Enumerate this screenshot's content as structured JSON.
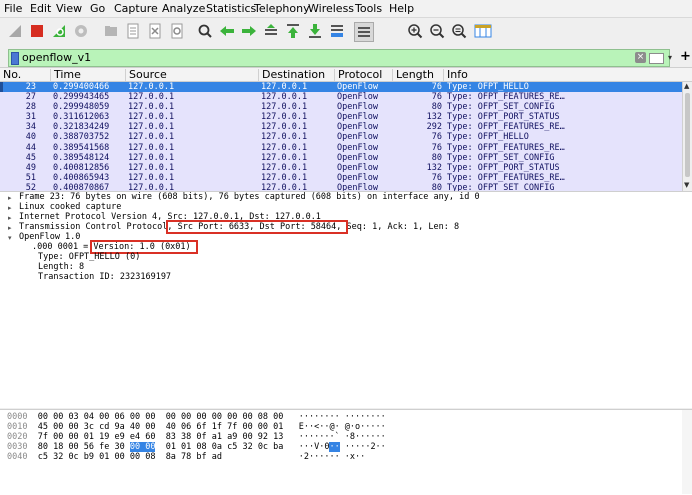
{
  "menu": [
    "File",
    "Edit",
    "View",
    "Go",
    "Capture",
    "Analyze",
    "Statistics",
    "Telephony",
    "Wireless",
    "Tools",
    "Help"
  ],
  "toolbar": {
    "icons": [
      "shark-fin-icon",
      "stop-icon",
      "restart-icon",
      "options-icon",
      "open-file-icon",
      "save-file-icon",
      "close-file-icon",
      "reload-icon",
      "find-icon",
      "go-back-icon",
      "go-forward-icon",
      "go-to-packet-icon",
      "first-packet-icon",
      "last-packet-icon",
      "auto-scroll-icon",
      "colorize-icon",
      "zoom-in-icon",
      "zoom-out-icon",
      "normal-size-icon",
      "resize-columns-icon"
    ]
  },
  "filter": {
    "value": "openflow_v1",
    "accent": "#b9f3b9",
    "clear_glyph": "×",
    "dropdown_glyph": "▾",
    "add_glyph": "+"
  },
  "packet_list": {
    "columns": [
      "No.",
      "Time",
      "Source",
      "Destination",
      "Protocol",
      "Length",
      "Info"
    ],
    "rows": [
      {
        "no": "23",
        "time": "0.299400466",
        "src": "127.0.0.1",
        "dst": "127.0.0.1",
        "proto": "OpenFlow",
        "len": "76",
        "info": "Type: OFPT_HELLO",
        "selected": true
      },
      {
        "no": "27",
        "time": "0.299943465",
        "src": "127.0.0.1",
        "dst": "127.0.0.1",
        "proto": "OpenFlow",
        "len": "76",
        "info": "Type: OFPT_FEATURES_RE…"
      },
      {
        "no": "28",
        "time": "0.299948059",
        "src": "127.0.0.1",
        "dst": "127.0.0.1",
        "proto": "OpenFlow",
        "len": "80",
        "info": "Type: OFPT_SET_CONFIG"
      },
      {
        "no": "31",
        "time": "0.311612063",
        "src": "127.0.0.1",
        "dst": "127.0.0.1",
        "proto": "OpenFlow",
        "len": "132",
        "info": "Type: OFPT_PORT_STATUS"
      },
      {
        "no": "34",
        "time": "0.321834249",
        "src": "127.0.0.1",
        "dst": "127.0.0.1",
        "proto": "OpenFlow",
        "len": "292",
        "info": "Type: OFPT_FEATURES_RE…"
      },
      {
        "no": "40",
        "time": "0.388703752",
        "src": "127.0.0.1",
        "dst": "127.0.0.1",
        "proto": "OpenFlow",
        "len": "76",
        "info": "Type: OFPT_HELLO"
      },
      {
        "no": "44",
        "time": "0.389541568",
        "src": "127.0.0.1",
        "dst": "127.0.0.1",
        "proto": "OpenFlow",
        "len": "76",
        "info": "Type: OFPT_FEATURES_RE…"
      },
      {
        "no": "45",
        "time": "0.389548124",
        "src": "127.0.0.1",
        "dst": "127.0.0.1",
        "proto": "OpenFlow",
        "len": "80",
        "info": "Type: OFPT_SET_CONFIG"
      },
      {
        "no": "49",
        "time": "0.400812856",
        "src": "127.0.0.1",
        "dst": "127.0.0.1",
        "proto": "OpenFlow",
        "len": "132",
        "info": "Type: OFPT_PORT_STATUS"
      },
      {
        "no": "51",
        "time": "0.400865943",
        "src": "127.0.0.1",
        "dst": "127.0.0.1",
        "proto": "OpenFlow",
        "len": "76",
        "info": "Type: OFPT_FEATURES_RE…"
      },
      {
        "no": "52",
        "time": "0.400870867",
        "src": "127.0.0.1",
        "dst": "127.0.0.1",
        "proto": "OpenFlow",
        "len": "80",
        "info": "Type: OFPT_SET_CONFIG"
      }
    ],
    "selected_color": "#3584e4",
    "row_color": "#e5e3fc"
  },
  "details": {
    "frame": "Frame 23: 76 bytes on wire (608 bits), 76 bytes captured (608 bits) on interface any, id 0",
    "linux": "Linux cooked capture",
    "ip": "Internet Protocol Version 4, Src: 127.0.0.1, Dst: 127.0.0.1",
    "tcp_prefix": "Transmission Control Protocol, ",
    "tcp_ports": "Src Port: 6633, Dst Port: 58464,",
    "tcp_suffix": " Seq: 1, Ack: 1, Len: 8",
    "openflow": "OpenFlow 1.0",
    "version_prefix": ".000 0001 = ",
    "version": "Version: 1.0 (0x01)",
    "type": "Type: OFPT_HELLO (0)",
    "length": "Length: 8",
    "xid": "Transaction ID: 2323169197",
    "highlight_color": "#d93025"
  },
  "bytes": {
    "lines": [
      {
        "off": "0000",
        "hex1": "00 00 03 04 00 06 00 00",
        "hex2": "00 00 00 00 00 00 08 00",
        "ascii": "········ ········"
      },
      {
        "off": "0010",
        "hex1": "45 00 00 3c cd 9a 40 00",
        "hex2": "40 06 6f 1f 7f 00 00 01",
        "ascii": "E··<··@· @·o·····"
      },
      {
        "off": "0020",
        "hex1": "7f 00 00 01 19 e9 e4 60",
        "hex2": "83 38 0f a1 a9 00 92 13",
        "ascii": "·······` ·8······"
      },
      {
        "off": "0030",
        "hex1_pre": "80 18 00 56 fe 30 ",
        "hex1_sel": "00 00",
        "hex2": "01 01 08 0a c5 32 0c ba",
        "ascii_pre": "···V·0",
        "ascii_sel": "··",
        "ascii_post": " ·····2··"
      },
      {
        "off": "0040",
        "hex1": "c5 32 0c b9 01 00 00 08",
        "hex2": "8a 78 bf ad",
        "ascii": "·2······ ·x··"
      }
    ]
  }
}
